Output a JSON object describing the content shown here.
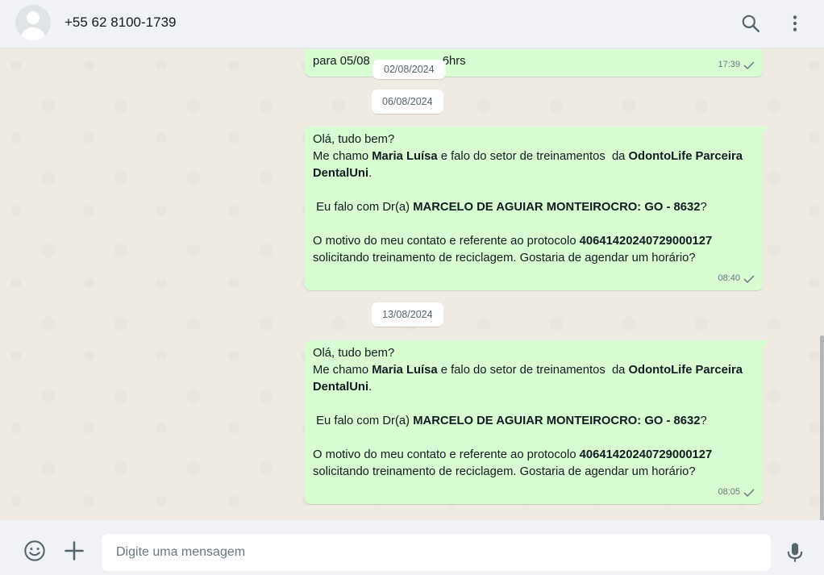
{
  "header": {
    "contact_name": "+55 62 8100-1739"
  },
  "messages": {
    "partial": {
      "text_pre": "para 05/08",
      "text_post": "6hrs",
      "time": "17:39"
    },
    "dates": {
      "d1": "02/08/2024",
      "d2": "06/08/2024",
      "d3": "13/08/2024"
    },
    "msg1": {
      "line1": "Olá, tudo bem?",
      "l2a": "Me chamo ",
      "l2b": "Maria Luísa",
      "l2c": " e falo do setor de treinamentos  da ",
      "l2d": "OdontoLife Parceira DentalUni",
      "l2e": ".",
      "l3a": " Eu falo com Dr(a) ",
      "l3b": "MARCELO DE AGUIAR MONTEIROCRO: GO - 8632",
      "l3c": "?",
      "l4a": "O motivo do meu contato e referente ao protocolo ",
      "l4b": "40641420240729000127",
      "l4c": " solicitando treinamento de reciclagem. Gostaria de agendar um horário?",
      "time": "08:40"
    },
    "msg2": {
      "line1": "Olá, tudo bem?",
      "l2a": "Me chamo ",
      "l2b": "Maria Luísa",
      "l2c": " e falo do setor de treinamentos  da ",
      "l2d": "OdontoLife Parceira DentalUni",
      "l2e": ".",
      "l3a": " Eu falo com Dr(a) ",
      "l3b": "MARCELO DE AGUIAR MONTEIROCRO: GO - 8632",
      "l3c": "?",
      "l4a": "O motivo do meu contato e referente ao protocolo ",
      "l4b": "40641420240729000127",
      "l4c": " solicitando treinamento de reciclagem. Gostaria de agendar um horário?",
      "time": "08:05"
    }
  },
  "footer": {
    "input_placeholder": "Digite uma mensagem"
  },
  "icons": {
    "search": "search-icon",
    "menu": "more-vertical-icon",
    "emoji": "emoji-icon",
    "attach": "plus-icon",
    "mic": "microphone-icon",
    "check": "single-check-icon"
  }
}
